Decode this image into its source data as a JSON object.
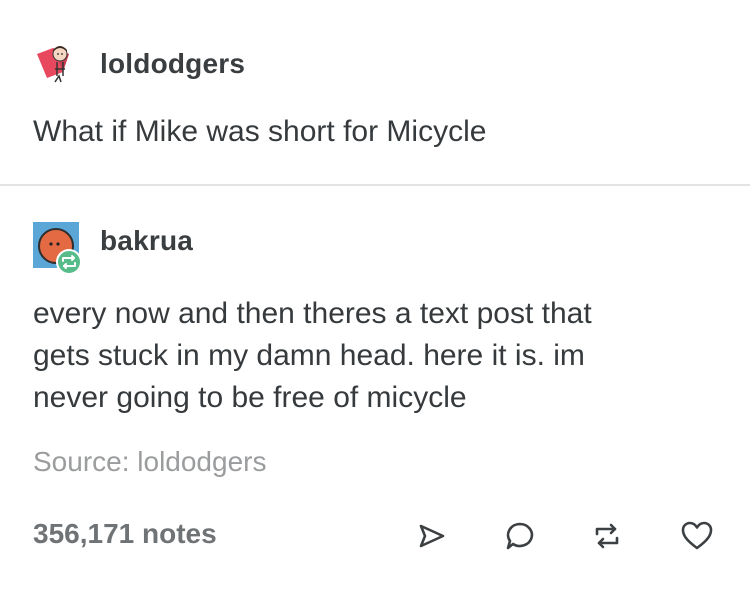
{
  "posts": [
    {
      "username": "loldodgers",
      "body_lines": [
        "What if Mike was short for Micycle"
      ]
    },
    {
      "username": "bakrua",
      "body_lines": [
        "every now and then theres a text post that",
        "gets stuck in my damn head. here it is. im",
        "never going to be free of micycle"
      ],
      "source": "Source: loldodgers",
      "notes": "356,171 notes"
    }
  ],
  "actions": [
    "share-icon",
    "reply-icon",
    "reblog-icon",
    "heart-icon"
  ],
  "colors": {
    "text": "#363a3c",
    "muted": "#9a9c9e",
    "notes": "#6f7375",
    "avatar_red": "#e8485e",
    "avatar_blue": "#5aa6d6",
    "reblog_badge": "#56bc8a"
  }
}
